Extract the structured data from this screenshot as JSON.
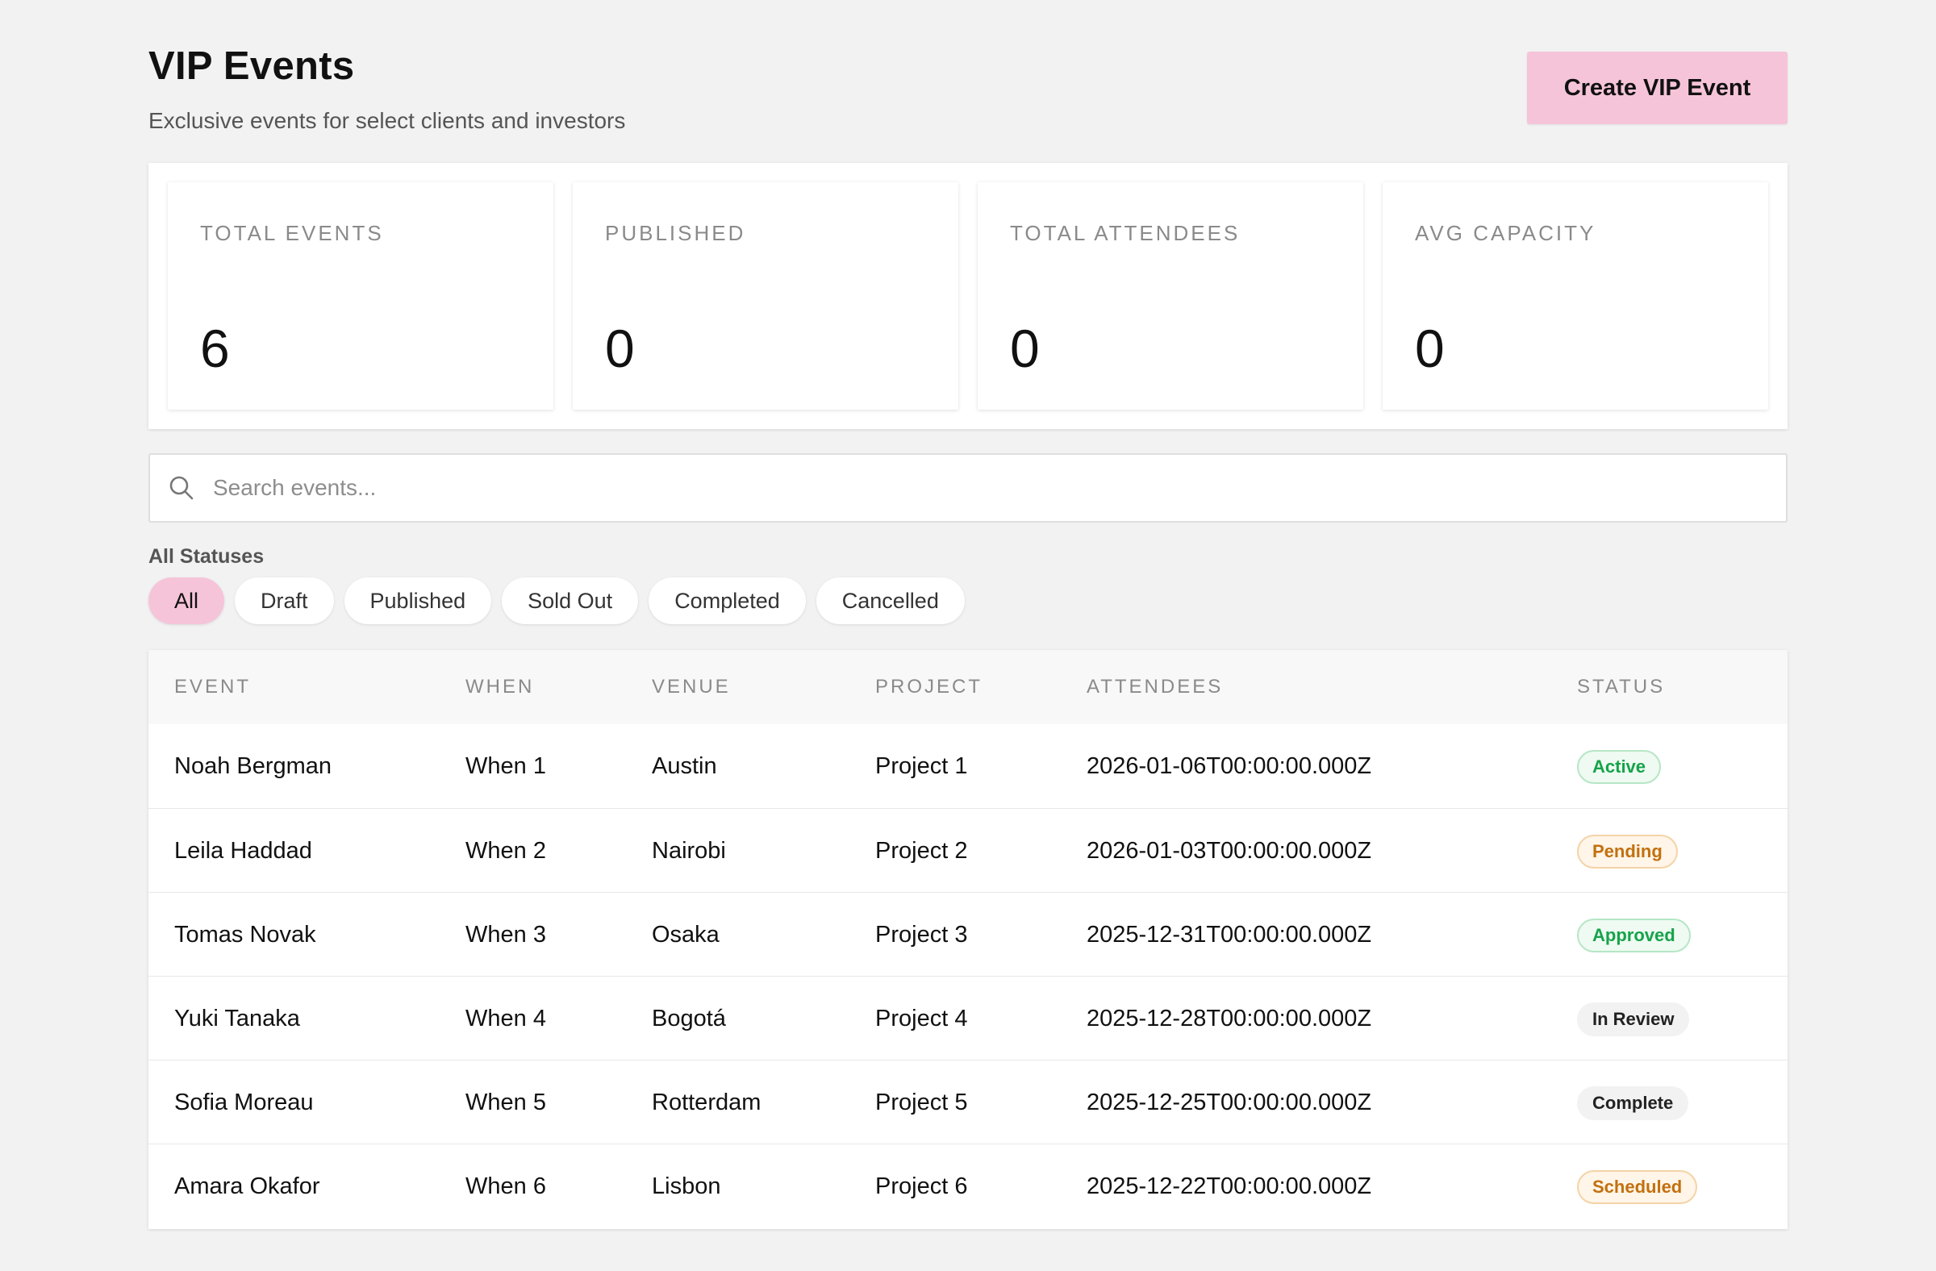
{
  "header": {
    "title": "VIP Events",
    "subtitle": "Exclusive events for select clients and investors",
    "create_label": "Create VIP Event"
  },
  "stats": [
    {
      "label": "TOTAL EVENTS",
      "value": "6"
    },
    {
      "label": "PUBLISHED",
      "value": "0"
    },
    {
      "label": "TOTAL ATTENDEES",
      "value": "0"
    },
    {
      "label": "AVG CAPACITY",
      "value": "0"
    }
  ],
  "search": {
    "placeholder": "Search events...",
    "value": ""
  },
  "filters": {
    "label": "All Statuses",
    "chips": [
      "All",
      "Draft",
      "Published",
      "Sold Out",
      "Completed",
      "Cancelled"
    ],
    "active": "All"
  },
  "table": {
    "columns": [
      "EVENT",
      "WHEN",
      "VENUE",
      "PROJECT",
      "ATTENDEES",
      "STATUS"
    ],
    "rows": [
      {
        "event": "Noah Bergman",
        "when": "When 1",
        "venue": "Austin",
        "project": "Project 1",
        "attendees": "2026-01-06T00:00:00.000Z",
        "status": "Active",
        "tone": "green"
      },
      {
        "event": "Leila Haddad",
        "when": "When 2",
        "venue": "Nairobi",
        "project": "Project 2",
        "attendees": "2026-01-03T00:00:00.000Z",
        "status": "Pending",
        "tone": "orange"
      },
      {
        "event": "Tomas Novak",
        "when": "When 3",
        "venue": "Osaka",
        "project": "Project 3",
        "attendees": "2025-12-31T00:00:00.000Z",
        "status": "Approved",
        "tone": "green"
      },
      {
        "event": "Yuki Tanaka",
        "when": "When 4",
        "venue": "Bogotá",
        "project": "Project 4",
        "attendees": "2025-12-28T00:00:00.000Z",
        "status": "In Review",
        "tone": "gray"
      },
      {
        "event": "Sofia Moreau",
        "when": "When 5",
        "venue": "Rotterdam",
        "project": "Project 5",
        "attendees": "2025-12-25T00:00:00.000Z",
        "status": "Complete",
        "tone": "gray"
      },
      {
        "event": "Amara Okafor",
        "when": "When 6",
        "venue": "Lisbon",
        "project": "Project 6",
        "attendees": "2025-12-22T00:00:00.000Z",
        "status": "Scheduled",
        "tone": "orange"
      }
    ]
  },
  "colors": {
    "accent": "#f6c4d9",
    "background": "#f2f2f2",
    "success": "#16a34a",
    "warning": "#c2700f"
  },
  "icons": {
    "search": "search-icon"
  }
}
